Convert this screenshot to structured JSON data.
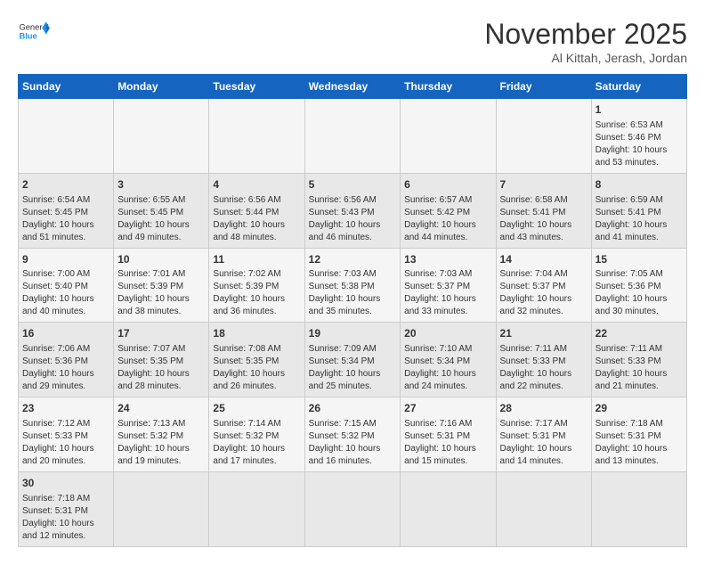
{
  "header": {
    "logo_general": "General",
    "logo_blue": "Blue",
    "month_title": "November 2025",
    "location": "Al Kittah, Jerash, Jordan"
  },
  "days_of_week": [
    "Sunday",
    "Monday",
    "Tuesday",
    "Wednesday",
    "Thursday",
    "Friday",
    "Saturday"
  ],
  "weeks": [
    [
      {
        "day": "",
        "info": ""
      },
      {
        "day": "",
        "info": ""
      },
      {
        "day": "",
        "info": ""
      },
      {
        "day": "",
        "info": ""
      },
      {
        "day": "",
        "info": ""
      },
      {
        "day": "",
        "info": ""
      },
      {
        "day": "1",
        "info": "Sunrise: 6:53 AM\nSunset: 5:46 PM\nDaylight: 10 hours and 53 minutes."
      }
    ],
    [
      {
        "day": "2",
        "info": "Sunrise: 6:54 AM\nSunset: 5:45 PM\nDaylight: 10 hours and 51 minutes."
      },
      {
        "day": "3",
        "info": "Sunrise: 6:55 AM\nSunset: 5:45 PM\nDaylight: 10 hours and 49 minutes."
      },
      {
        "day": "4",
        "info": "Sunrise: 6:56 AM\nSunset: 5:44 PM\nDaylight: 10 hours and 48 minutes."
      },
      {
        "day": "5",
        "info": "Sunrise: 6:56 AM\nSunset: 5:43 PM\nDaylight: 10 hours and 46 minutes."
      },
      {
        "day": "6",
        "info": "Sunrise: 6:57 AM\nSunset: 5:42 PM\nDaylight: 10 hours and 44 minutes."
      },
      {
        "day": "7",
        "info": "Sunrise: 6:58 AM\nSunset: 5:41 PM\nDaylight: 10 hours and 43 minutes."
      },
      {
        "day": "8",
        "info": "Sunrise: 6:59 AM\nSunset: 5:41 PM\nDaylight: 10 hours and 41 minutes."
      }
    ],
    [
      {
        "day": "9",
        "info": "Sunrise: 7:00 AM\nSunset: 5:40 PM\nDaylight: 10 hours and 40 minutes."
      },
      {
        "day": "10",
        "info": "Sunrise: 7:01 AM\nSunset: 5:39 PM\nDaylight: 10 hours and 38 minutes."
      },
      {
        "day": "11",
        "info": "Sunrise: 7:02 AM\nSunset: 5:39 PM\nDaylight: 10 hours and 36 minutes."
      },
      {
        "day": "12",
        "info": "Sunrise: 7:03 AM\nSunset: 5:38 PM\nDaylight: 10 hours and 35 minutes."
      },
      {
        "day": "13",
        "info": "Sunrise: 7:03 AM\nSunset: 5:37 PM\nDaylight: 10 hours and 33 minutes."
      },
      {
        "day": "14",
        "info": "Sunrise: 7:04 AM\nSunset: 5:37 PM\nDaylight: 10 hours and 32 minutes."
      },
      {
        "day": "15",
        "info": "Sunrise: 7:05 AM\nSunset: 5:36 PM\nDaylight: 10 hours and 30 minutes."
      }
    ],
    [
      {
        "day": "16",
        "info": "Sunrise: 7:06 AM\nSunset: 5:36 PM\nDaylight: 10 hours and 29 minutes."
      },
      {
        "day": "17",
        "info": "Sunrise: 7:07 AM\nSunset: 5:35 PM\nDaylight: 10 hours and 28 minutes."
      },
      {
        "day": "18",
        "info": "Sunrise: 7:08 AM\nSunset: 5:35 PM\nDaylight: 10 hours and 26 minutes."
      },
      {
        "day": "19",
        "info": "Sunrise: 7:09 AM\nSunset: 5:34 PM\nDaylight: 10 hours and 25 minutes."
      },
      {
        "day": "20",
        "info": "Sunrise: 7:10 AM\nSunset: 5:34 PM\nDaylight: 10 hours and 24 minutes."
      },
      {
        "day": "21",
        "info": "Sunrise: 7:11 AM\nSunset: 5:33 PM\nDaylight: 10 hours and 22 minutes."
      },
      {
        "day": "22",
        "info": "Sunrise: 7:11 AM\nSunset: 5:33 PM\nDaylight: 10 hours and 21 minutes."
      }
    ],
    [
      {
        "day": "23",
        "info": "Sunrise: 7:12 AM\nSunset: 5:33 PM\nDaylight: 10 hours and 20 minutes."
      },
      {
        "day": "24",
        "info": "Sunrise: 7:13 AM\nSunset: 5:32 PM\nDaylight: 10 hours and 19 minutes."
      },
      {
        "day": "25",
        "info": "Sunrise: 7:14 AM\nSunset: 5:32 PM\nDaylight: 10 hours and 17 minutes."
      },
      {
        "day": "26",
        "info": "Sunrise: 7:15 AM\nSunset: 5:32 PM\nDaylight: 10 hours and 16 minutes."
      },
      {
        "day": "27",
        "info": "Sunrise: 7:16 AM\nSunset: 5:31 PM\nDaylight: 10 hours and 15 minutes."
      },
      {
        "day": "28",
        "info": "Sunrise: 7:17 AM\nSunset: 5:31 PM\nDaylight: 10 hours and 14 minutes."
      },
      {
        "day": "29",
        "info": "Sunrise: 7:18 AM\nSunset: 5:31 PM\nDaylight: 10 hours and 13 minutes."
      }
    ],
    [
      {
        "day": "30",
        "info": "Sunrise: 7:18 AM\nSunset: 5:31 PM\nDaylight: 10 hours and 12 minutes."
      },
      {
        "day": "",
        "info": ""
      },
      {
        "day": "",
        "info": ""
      },
      {
        "day": "",
        "info": ""
      },
      {
        "day": "",
        "info": ""
      },
      {
        "day": "",
        "info": ""
      },
      {
        "day": "",
        "info": ""
      }
    ]
  ]
}
